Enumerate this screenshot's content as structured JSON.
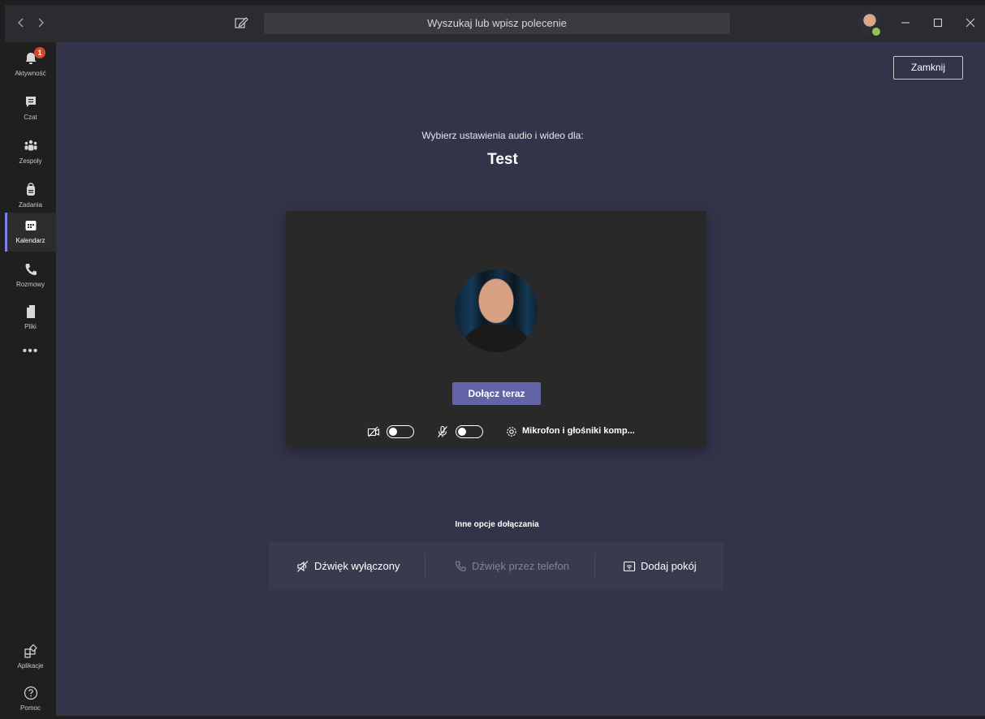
{
  "titlebar": {
    "search_placeholder": "Wyszukaj lub wpisz polecenie",
    "back_icon": "chevron-left-icon",
    "forward_icon": "chevron-right-icon",
    "compose_icon": "compose-icon",
    "minimize_symbol": "—",
    "maximize_symbol": "☐",
    "close_symbol": "✕"
  },
  "rail": {
    "activity": {
      "label": "Aktywność",
      "badge": "1"
    },
    "chat": {
      "label": "Czat"
    },
    "teams": {
      "label": "Zespoły"
    },
    "assignments": {
      "label": "Zadania"
    },
    "calendar": {
      "label": "Kalendarz"
    },
    "calls": {
      "label": "Rozmowy"
    },
    "files": {
      "label": "Pliki"
    },
    "more": {
      "label": "•••"
    },
    "apps": {
      "label": "Aplikacje"
    },
    "help": {
      "label": "Pomoc"
    }
  },
  "main": {
    "close_label": "Zamknij",
    "subtitle": "Wybierz ustawienia audio i wideo dla:",
    "meeting_title": "Test",
    "join_label": "Dołącz teraz",
    "device_label": "Mikrofon i głośniki komp...",
    "camera_on": false,
    "mic_on": false,
    "other_options_title": "Inne opcje dołączania",
    "options": [
      {
        "label": "Dźwięk wyłączony",
        "enabled": true
      },
      {
        "label": "Dźwięk przez telefon",
        "enabled": false
      },
      {
        "label": "Dodaj pokój",
        "enabled": true
      }
    ]
  },
  "colors": {
    "accent": "#6264a7",
    "rail_active": "#7b83eb",
    "badge": "#cc4a31",
    "presence": "#92c353",
    "main_bg": "#33344a"
  }
}
